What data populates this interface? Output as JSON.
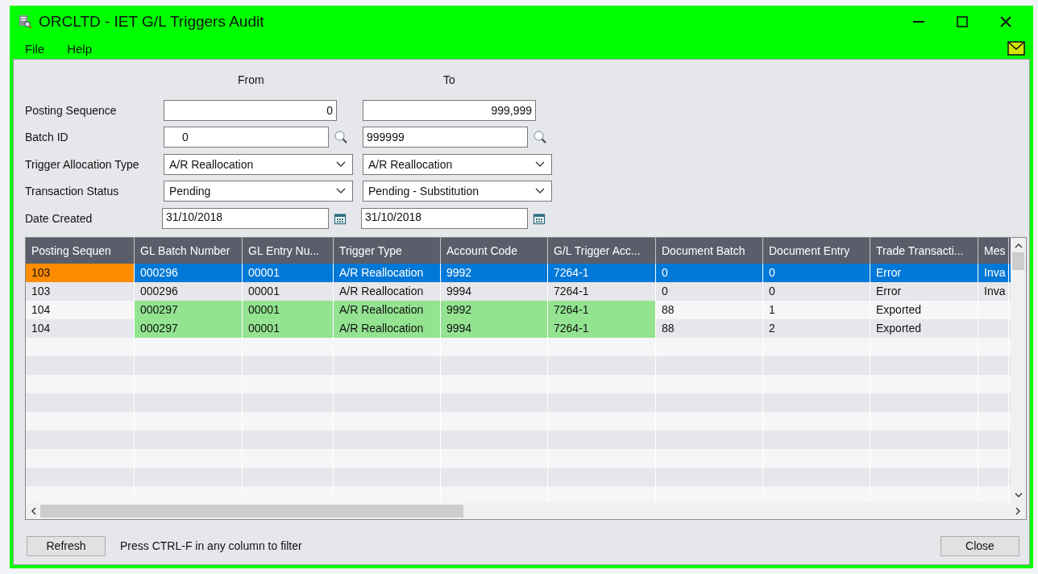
{
  "window": {
    "title": "ORCLTD - IET G/L Triggers Audit"
  },
  "menu": [
    "File",
    "Help"
  ],
  "filters": {
    "from_label": "From",
    "to_label": "To",
    "rows": [
      {
        "label": "Posting Sequence",
        "kind": "number",
        "from": "0",
        "to": "999,999"
      },
      {
        "label": "Batch ID",
        "kind": "lookup",
        "from": "0",
        "to": "999999"
      },
      {
        "label": "Trigger Allocation Type",
        "kind": "select",
        "from": "A/R Reallocation",
        "to": "A/R Reallocation"
      },
      {
        "label": "Transaction Status",
        "kind": "select",
        "from": "Pending",
        "to": "Pending - Substitution"
      },
      {
        "label": "Date Created",
        "kind": "date",
        "from": "31/10/2018",
        "to": "31/10/2018"
      }
    ]
  },
  "table": {
    "columns": [
      "Posting Sequen",
      "GL Batch Number",
      "GL Entry Nu...",
      "Trigger Type",
      "Account Code",
      "G/L Trigger Acc...",
      "Document Batch",
      "Document Entry",
      "Trade Transacti...",
      "Mes"
    ],
    "rows": [
      {
        "selected": true,
        "focused": true,
        "highlighted": false,
        "cells": [
          "103",
          "000296",
          "00001",
          "A/R Reallocation",
          "9992",
          "7264-1",
          "0",
          "0",
          "Error",
          "Inva"
        ]
      },
      {
        "selected": false,
        "focused": false,
        "highlighted": false,
        "cells": [
          "103",
          "000296",
          "00001",
          "A/R Reallocation",
          "9994",
          "7264-1",
          "0",
          "0",
          "Error",
          "Inva"
        ]
      },
      {
        "selected": false,
        "focused": false,
        "highlighted": true,
        "cells": [
          "104",
          "000297",
          "00001",
          "A/R Reallocation",
          "9992",
          "7264-1",
          "88",
          "1",
          "Exported",
          ""
        ]
      },
      {
        "selected": false,
        "focused": false,
        "highlighted": true,
        "cells": [
          "104",
          "000297",
          "00001",
          "A/R Reallocation",
          "9994",
          "7264-1",
          "88",
          "2",
          "Exported",
          ""
        ]
      }
    ]
  },
  "footer": {
    "refresh": "Refresh",
    "hint": "Press CTRL-F in any column to filter",
    "close": "Close"
  }
}
